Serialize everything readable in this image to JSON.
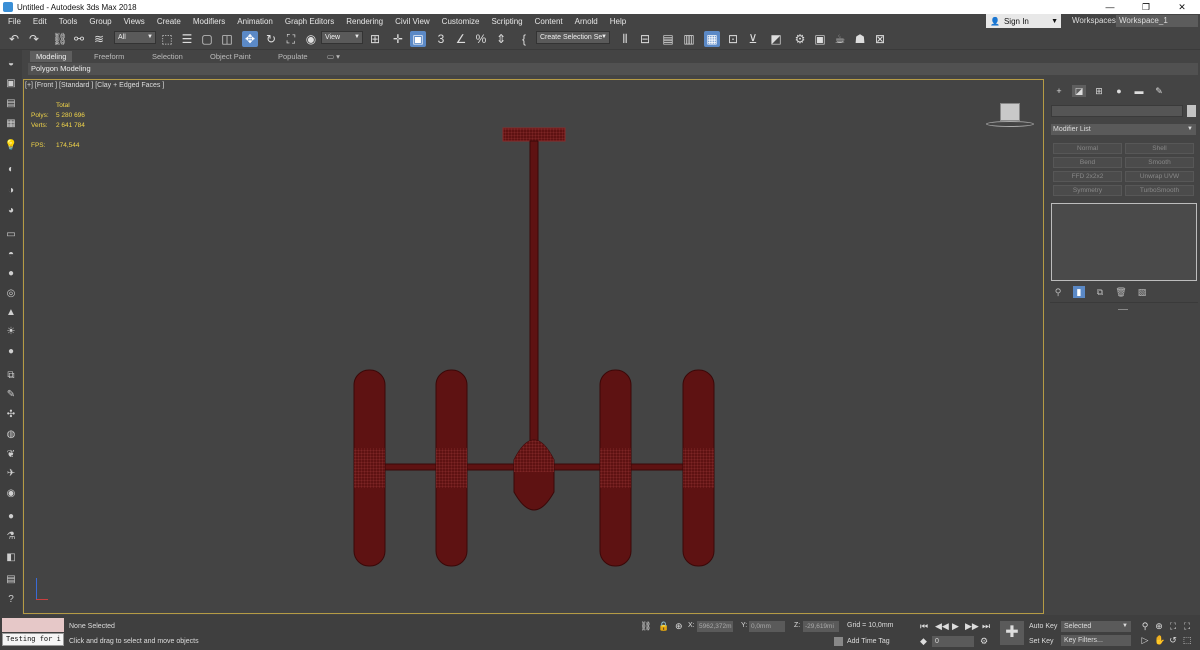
{
  "window": {
    "title": "Untitled - Autodesk 3ds Max 2018",
    "minimize": "—",
    "maximize": "❐",
    "close": "✕"
  },
  "menu": [
    "File",
    "Edit",
    "Tools",
    "Group",
    "Views",
    "Create",
    "Modifiers",
    "Animation",
    "Graph Editors",
    "Rendering",
    "Civil View",
    "Customize",
    "Scripting",
    "Content",
    "Arnold",
    "Help"
  ],
  "account": {
    "signin": "Sign In",
    "workspaces_label": "Workspaces:",
    "workspace": "Workspace_1"
  },
  "toolbar": {
    "selection_filter": "All",
    "ref_coord": "View",
    "named_selection": "Create Selection Se"
  },
  "ribbon": {
    "tabs": [
      "Modeling",
      "Freeform",
      "Selection",
      "Object Paint",
      "Populate"
    ],
    "subtitle": "Polygon Modeling"
  },
  "viewport": {
    "label": "[+] [Front ] [Standard ] [Clay + Edged Faces ]",
    "stats": {
      "header": "Total",
      "polys_label": "Polys:",
      "polys": "5 280 696",
      "verts_label": "Verts:",
      "verts": "2 641 784",
      "fps_label": "FPS:",
      "fps": "174,544"
    },
    "model_color": "#5e1212",
    "highlight_color": "#b59b45"
  },
  "command_panel": {
    "modifier_list": "Modifier List",
    "modifier_buttons": [
      "Normal",
      "Shell",
      "Bend",
      "Smooth",
      "FFD 2x2x2",
      "Unwrap UVW",
      "Symmetry",
      "TurboSmooth"
    ]
  },
  "status": {
    "selected": "None Selected",
    "prompt": "Click and drag to select and move objects",
    "maxscript": "Testing for i",
    "x_label": "X:",
    "x": "5962,372m",
    "y_label": "Y:",
    "y": "0,0mm",
    "z_label": "Z:",
    "z": "-29,619mi",
    "grid": "Grid = 10,0mm",
    "add_time_tag": "Add Time Tag",
    "frame": "0",
    "auto_key": "Auto Key",
    "set_key": "Set Key",
    "key_mode": "Selected",
    "key_filters": "Key Filters..."
  }
}
